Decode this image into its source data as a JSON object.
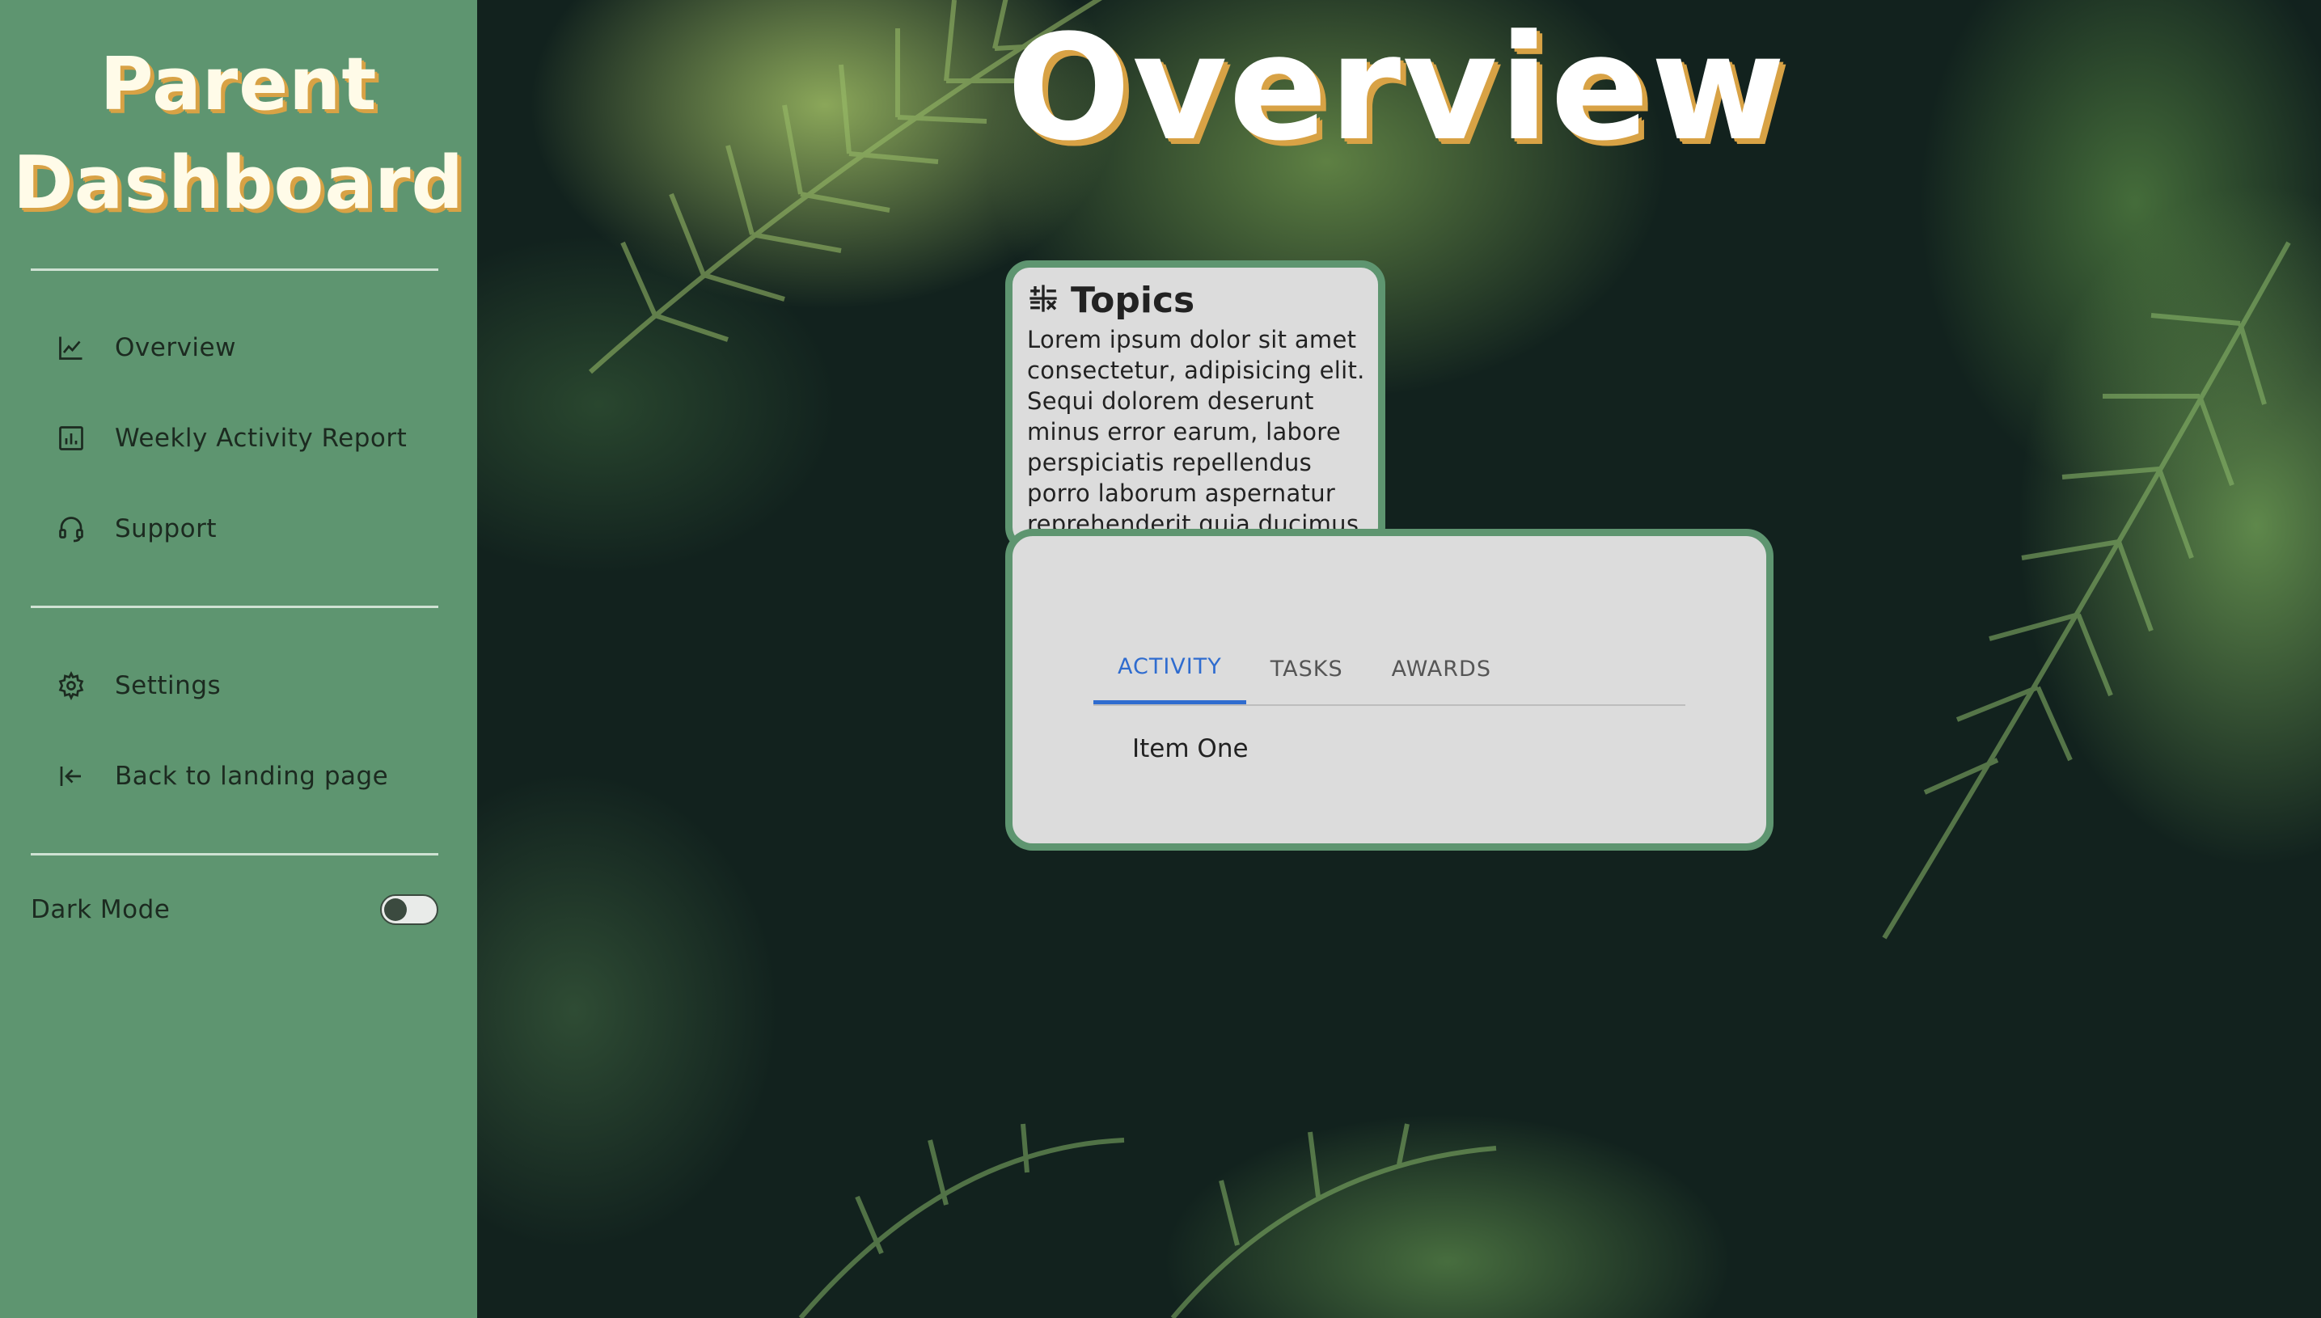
{
  "sidebar": {
    "brand_line1": "Parent",
    "brand_line2": "Dashboard",
    "nav_primary": [
      {
        "label": "Overview",
        "icon": "line-chart-icon"
      },
      {
        "label": "Weekly Activity Report",
        "icon": "bar-chart-icon"
      },
      {
        "label": "Support",
        "icon": "headset-icon"
      }
    ],
    "nav_secondary": [
      {
        "label": "Settings",
        "icon": "gear-icon"
      },
      {
        "label": "Back to landing page",
        "icon": "exit-icon"
      }
    ],
    "dark_mode_label": "Dark Mode",
    "dark_mode_on": false
  },
  "main": {
    "title": "Overview",
    "topics": {
      "title": "Topics",
      "icon": "calculator-icon",
      "body": "Lorem ipsum dolor sit amet consectetur, adipisicing elit. Sequi dolorem deserunt minus error earum, labore perspiciatis repellendus porro laborum aspernatur reprehenderit quia ducimus"
    },
    "tabs": [
      {
        "label": "ACTIVITY",
        "active": true
      },
      {
        "label": "TASKS",
        "active": false
      },
      {
        "label": "AWARDS",
        "active": false
      }
    ],
    "tab_panel_text": "Item One"
  },
  "colors": {
    "sidebar_bg": "#5e9570",
    "title_shadow": "#d8a245",
    "tab_active": "#2f6ccf",
    "card_bg": "#dcdcdc"
  }
}
